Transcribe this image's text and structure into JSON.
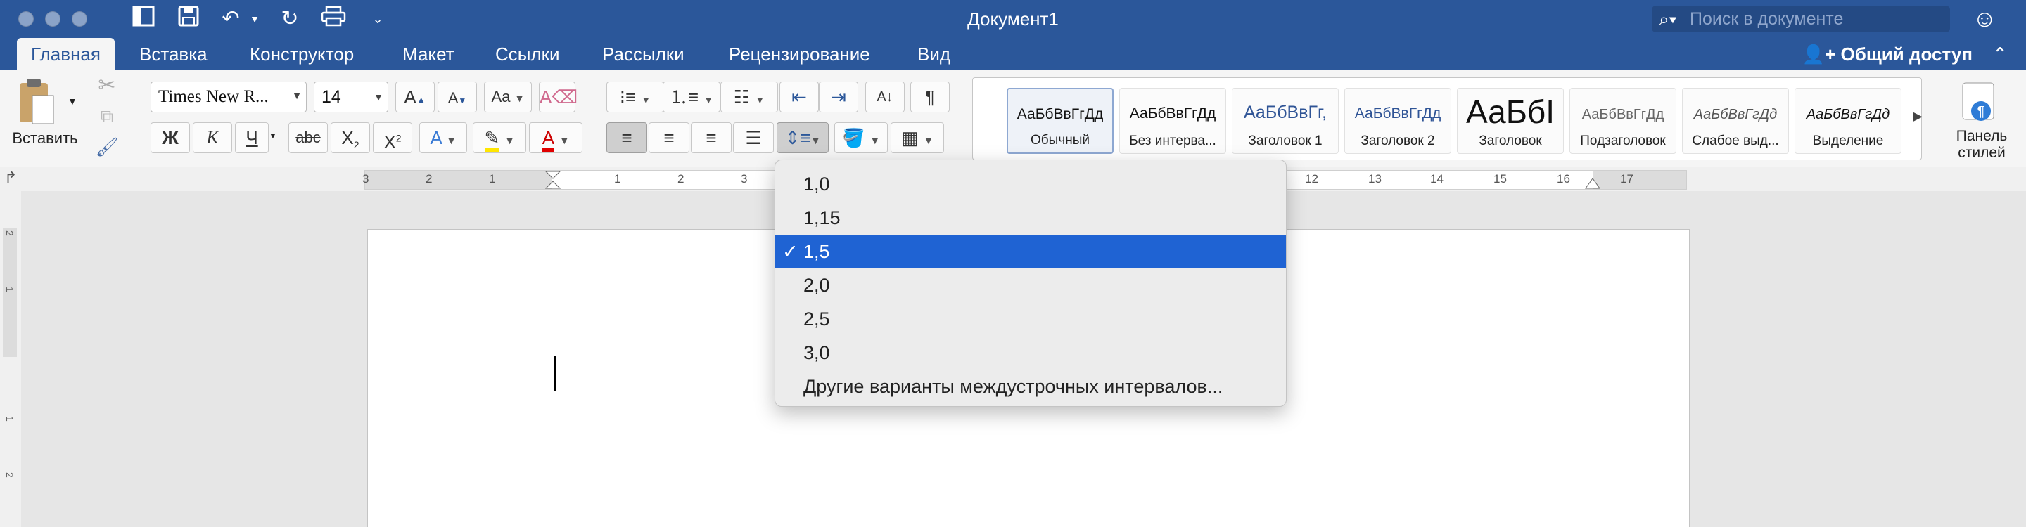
{
  "window": {
    "title": "Документ1"
  },
  "search": {
    "placeholder": "Поиск в документе"
  },
  "tabs": [
    "Главная",
    "Вставка",
    "Конструктор",
    "Макет",
    "Ссылки",
    "Рассылки",
    "Рецензирование",
    "Вид"
  ],
  "share_label": "Общий доступ",
  "clipboard": {
    "paste_label": "Вставить"
  },
  "font": {
    "name": "Times New R...",
    "size": "14"
  },
  "format_buttons": {
    "bold": "Ж",
    "italic": "К",
    "underline": "Ч",
    "strike": "abc"
  },
  "styles": [
    {
      "sample": "АаБбВвГгДд",
      "name": "Обычный"
    },
    {
      "sample": "АаБбВвГгДд",
      "name": "Без интерва..."
    },
    {
      "sample": "АаБбВвГг,",
      "name": "Заголовок 1"
    },
    {
      "sample": "АаБбВвГгДд",
      "name": "Заголовок 2"
    },
    {
      "sample": "АаБбІ",
      "name": "Заголовок"
    },
    {
      "sample": "АаБбВвГгДд",
      "name": "Подзаголовок"
    },
    {
      "sample": "АаБбВвГгДд",
      "name": "Слабое выд..."
    },
    {
      "sample": "АаБбВвГгДд",
      "name": "Выделение"
    }
  ],
  "styles_pane_label": "Панель стилей",
  "ruler": {
    "ticks": [
      "3",
      "2",
      "1",
      "1",
      "2",
      "3",
      "12",
      "13",
      "14",
      "15",
      "16",
      "17"
    ]
  },
  "vruler": {
    "ticks": [
      "2",
      "1",
      "1",
      "2"
    ]
  },
  "line_spacing_menu": {
    "items": [
      "1,0",
      "1,15",
      "1,5",
      "2,0",
      "2,5",
      "3,0",
      "Другие варианты междустрочных интервалов..."
    ],
    "selected_index": 2,
    "check_glyph": "✓"
  },
  "colors": {
    "accent": "#2b579a",
    "selection": "#1f63d3",
    "highlight": "#ffe600",
    "font_color": "#e00000"
  }
}
